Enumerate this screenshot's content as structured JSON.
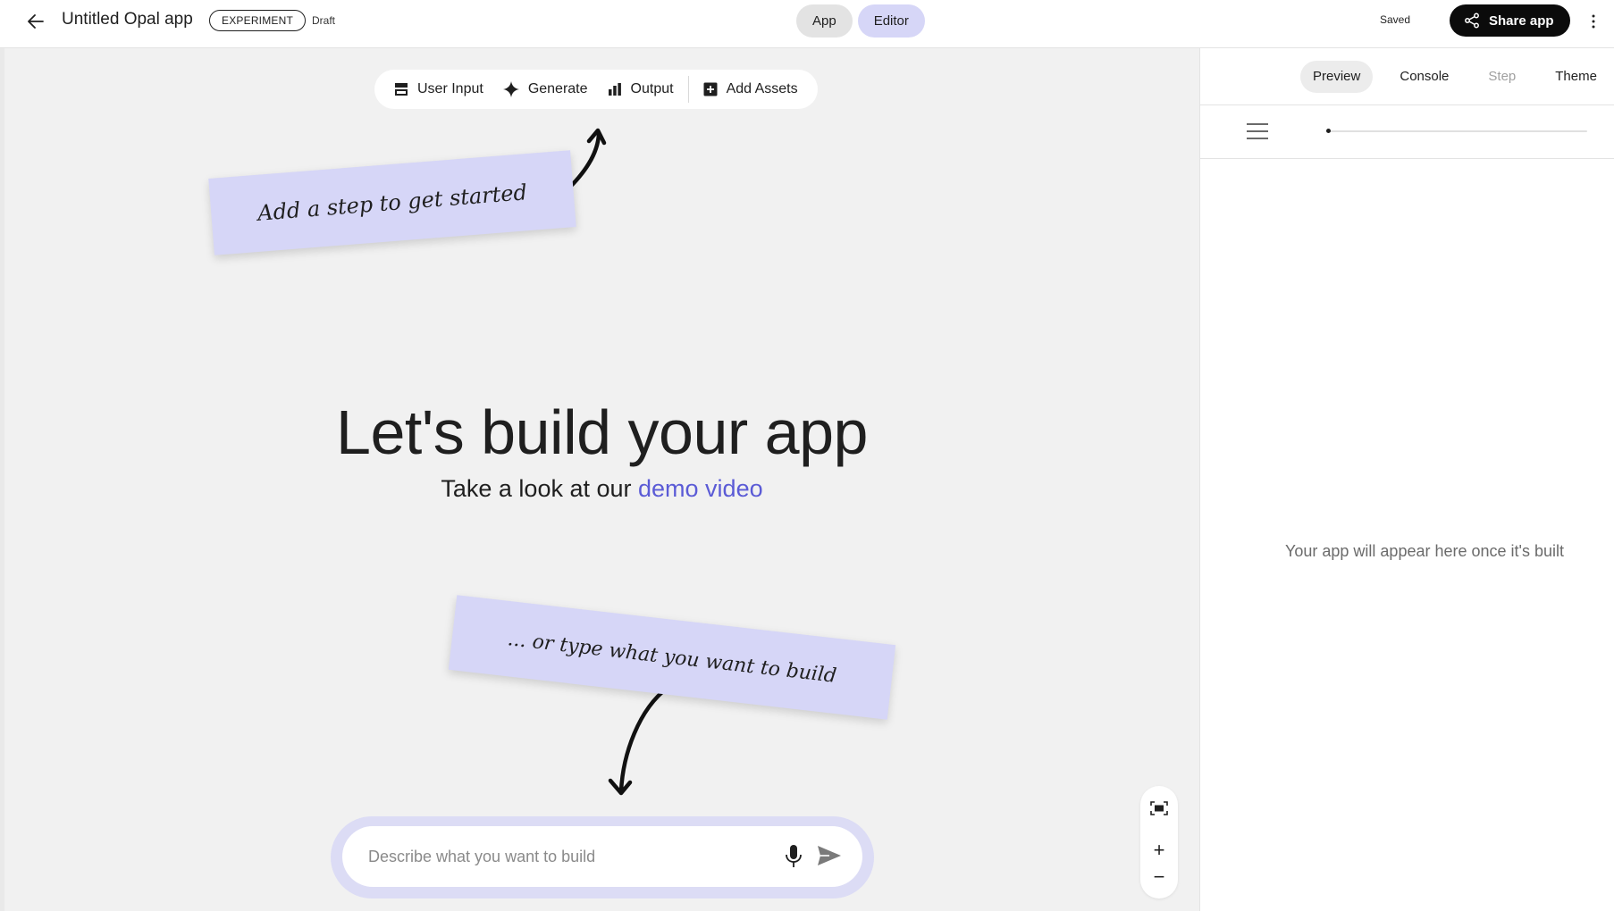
{
  "header": {
    "back_icon": "arrow-back-icon",
    "title": "Untitled Opal app",
    "badge": "EXPERIMENT",
    "status": "Draft",
    "modes": [
      {
        "label": "App",
        "active": false
      },
      {
        "label": "Editor",
        "active": true
      }
    ],
    "saved": "Saved",
    "share_label": "Share app",
    "share_icon": "share-icon",
    "more_icon": "more-vert-icon"
  },
  "toolbar": {
    "items": [
      {
        "label": "User Input",
        "icon": "user-input-icon"
      },
      {
        "label": "Generate",
        "icon": "sparkle-icon"
      },
      {
        "label": "Output",
        "icon": "output-chart-icon"
      },
      {
        "label": "Add Assets",
        "icon": "add-box-icon"
      }
    ]
  },
  "canvas": {
    "note_top": "Add a step to get started",
    "note_bottom": "... or type what you want to build",
    "hero_title": "Let's build your app",
    "hero_sub_prefix": "Take a look at our ",
    "hero_sub_link": "demo video",
    "prompt_placeholder": "Describe what you want to build",
    "prompt_value": "",
    "mic_icon": "mic-icon",
    "send_icon": "send-icon",
    "zoom": {
      "fit_icon": "fit-screen-icon",
      "zoom_in": "+",
      "zoom_out": "−"
    }
  },
  "panel": {
    "tabs": [
      {
        "label": "Preview",
        "state": "active"
      },
      {
        "label": "Console",
        "state": "normal"
      },
      {
        "label": "Step",
        "state": "disabled"
      },
      {
        "label": "Theme",
        "state": "normal"
      }
    ],
    "menu_icon": "hamburger-menu-icon",
    "progress": 0,
    "empty_text": "Your app will appear here once it's built"
  },
  "colors": {
    "accent_lavender": "#d6d6f7",
    "link": "#5b5bd6",
    "canvas_bg": "#f1f1f1",
    "share_bg": "#0b0b0b"
  }
}
